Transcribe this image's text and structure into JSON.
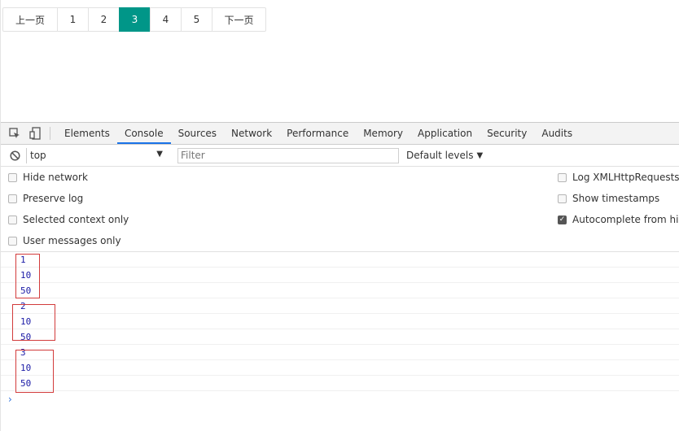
{
  "pagination": {
    "prev_label": "上一页",
    "pages": [
      "1",
      "2",
      "3",
      "4",
      "5"
    ],
    "current": "3",
    "next_label": "下一页",
    "active_color": "#009688"
  },
  "devtools": {
    "tabs": [
      "Elements",
      "Console",
      "Sources",
      "Network",
      "Performance",
      "Memory",
      "Application",
      "Security",
      "Audits"
    ],
    "active_tab": "Console",
    "context": "top",
    "filter_placeholder": "Filter",
    "levels_label": "Default levels",
    "settings_left": [
      {
        "label": "Hide network",
        "checked": false
      },
      {
        "label": "Preserve log",
        "checked": false
      },
      {
        "label": "Selected context only",
        "checked": false
      },
      {
        "label": "User messages only",
        "checked": false
      }
    ],
    "settings_right": [
      {
        "label": "Log XMLHttpRequests",
        "checked": false
      },
      {
        "label": "Show timestamps",
        "checked": false
      },
      {
        "label": "Autocomplete from history",
        "checked": true
      }
    ],
    "console_lines": [
      "1",
      "10",
      "50",
      "2",
      "10",
      "50",
      "3",
      "10",
      "50"
    ],
    "prompt_glyph": "›"
  }
}
